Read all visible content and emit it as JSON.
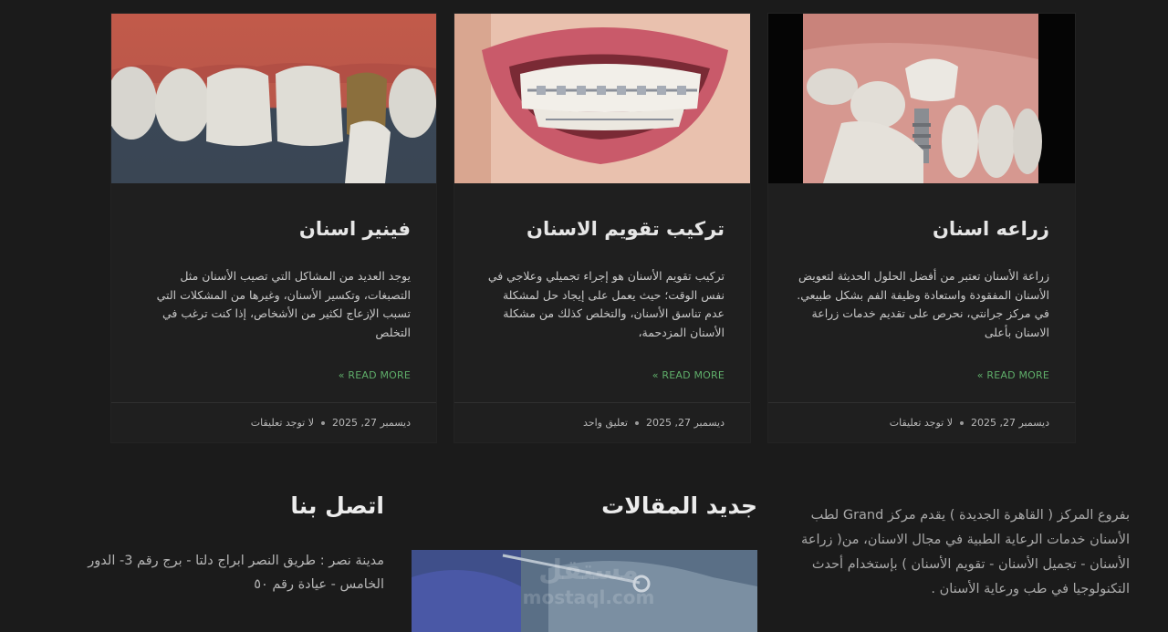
{
  "cards": [
    {
      "title": "فينير اسنان",
      "excerpt": "يوجد العديد من المشاكل التي تصيب الأسنان مثل التصبغات، وتكسير الأسنان، وغيرها من المشكلات التي تسبب الإزعاج لكثير من الأشخاص، إذا كنت ترغب في التخلص",
      "read_more": "« READ MORE",
      "date": "ديسمبر 27, 2025",
      "comments": "لا توجد تعليقات",
      "image_icon": "veneer-teeth-image"
    },
    {
      "title": "تركيب تقويم الاسنان",
      "excerpt": "تركيب تقويم الأسنان هو إجراء تجميلي وعلاجي في نفس الوقت؛ حيث يعمل على إيجاد حل لمشكلة عدم تناسق الأسنان، والتخلص كذلك من مشكلة الأسنان المزدحمة،",
      "read_more": "« READ MORE",
      "date": "ديسمبر 27, 2025",
      "comments": "تعليق واحد",
      "image_icon": "braces-smile-image"
    },
    {
      "title": "زراعه اسنان",
      "excerpt": "زراعة الأسنان تعتبر من أفضل الحلول الحديثة لتعويض الأسنان المفقودة واستعادة وظيفة الفم بشكل طبيعي. في مركز جرانتي، نحرص على تقديم خدمات زراعة الاسنان بأعلى",
      "read_more": "« READ MORE",
      "date": "ديسمبر 27, 2025",
      "comments": "لا توجد تعليقات",
      "image_icon": "dental-implant-image"
    }
  ],
  "footer": {
    "about": "بفروع المركز ( القاهرة الجديدة ) يقدم مركز Grand لطب الأسنان خدمات الرعاية الطبية في مجال الاسنان، من( زراعة الأسنان - تجميل الأسنان - تقويم الأسنان ) بإستخدام أحدث التكنولوجيا في طب ورعاية الأسنان .",
    "news_title": "جديد المقالات",
    "contact_title": "اتصل بنا",
    "contact_address": "مدينة نصر : طريق النصر ابراج دلتا - برج رقم 3- الدور الخامس - عيادة رقم ٥٠"
  },
  "watermark": {
    "line1": "مستقل",
    "line2": "mostaql.com"
  },
  "colors": {
    "background": "#1b1b1b",
    "card": "#1f1f1f",
    "link": "#5fae6a"
  }
}
